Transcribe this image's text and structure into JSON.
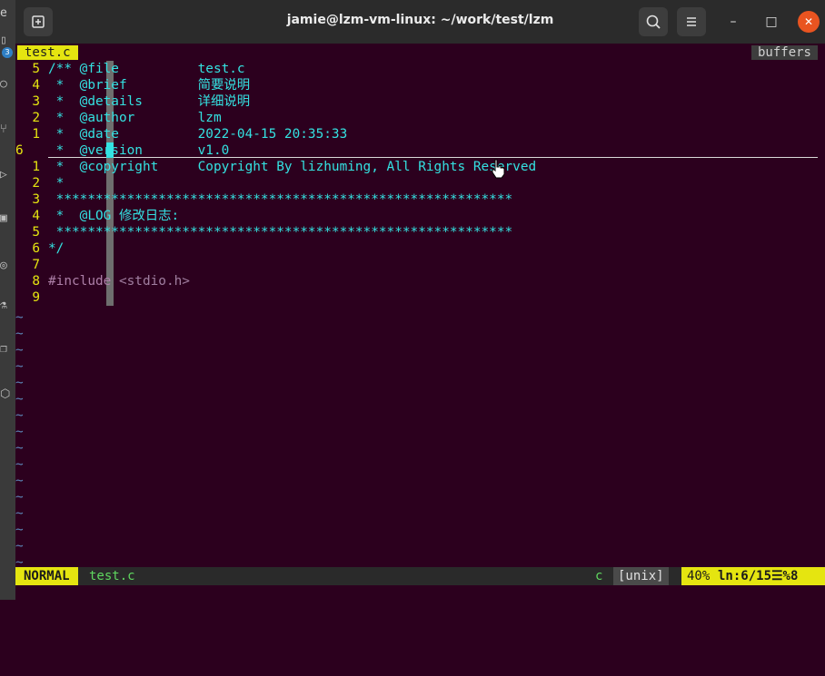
{
  "window": {
    "title": "jamie@lzm-vm-linux: ~/work/test/lzm",
    "new_tab_icon": "new-tab-icon",
    "search_icon": "search-icon",
    "menu_icon": "hamburger-menu-icon",
    "minimize_glyph": "–",
    "maximize_glyph": "□",
    "close_glyph": "✕"
  },
  "dock": {
    "badge_count": "3",
    "label_fragment": "e"
  },
  "tabline": {
    "active_tab": "test.c",
    "buffers_label": "buffers"
  },
  "editor": {
    "lines": [
      {
        "num": "5",
        "text": "/** @file          test.c"
      },
      {
        "num": "4",
        "text": " *  @brief         简要说明"
      },
      {
        "num": "3",
        "text": " *  @details       详细说明"
      },
      {
        "num": "2",
        "text": " *  @author        lzm"
      },
      {
        "num": "1",
        "text": " *  @date          2022-04-15 20:35:33"
      },
      {
        "num": "6",
        "text": " *  @version       v1.0"
      },
      {
        "num": "1",
        "text": " *  @copyright     Copyright By lizhuming, All Rights Reserved"
      },
      {
        "num": "2",
        "text": " *"
      },
      {
        "num": "3",
        "text": " **********************************************************"
      },
      {
        "num": "4",
        "text": " *  @LOG 修改日志:"
      },
      {
        "num": "5",
        "text": " **********************************************************"
      },
      {
        "num": "6",
        "text": "*/"
      },
      {
        "num": "7",
        "text": ""
      },
      {
        "num": "8",
        "directive": "#include",
        "header": " <stdio.h>"
      },
      {
        "num": "9",
        "text": ""
      }
    ],
    "tilde": "~",
    "tilde_count": 16
  },
  "statusline": {
    "mode": "NORMAL",
    "filename": "test.c",
    "filetype": "c",
    "fileformat": "[unix]",
    "percent": "40%",
    "position": "ln:6/15☰%8"
  },
  "colors": {
    "background": "#2c001e",
    "comment": "#34e2e2",
    "line_number": "#e5e510",
    "tilde": "#5b87b8",
    "mode_bg": "#e5e510",
    "close_button": "#e95420"
  }
}
